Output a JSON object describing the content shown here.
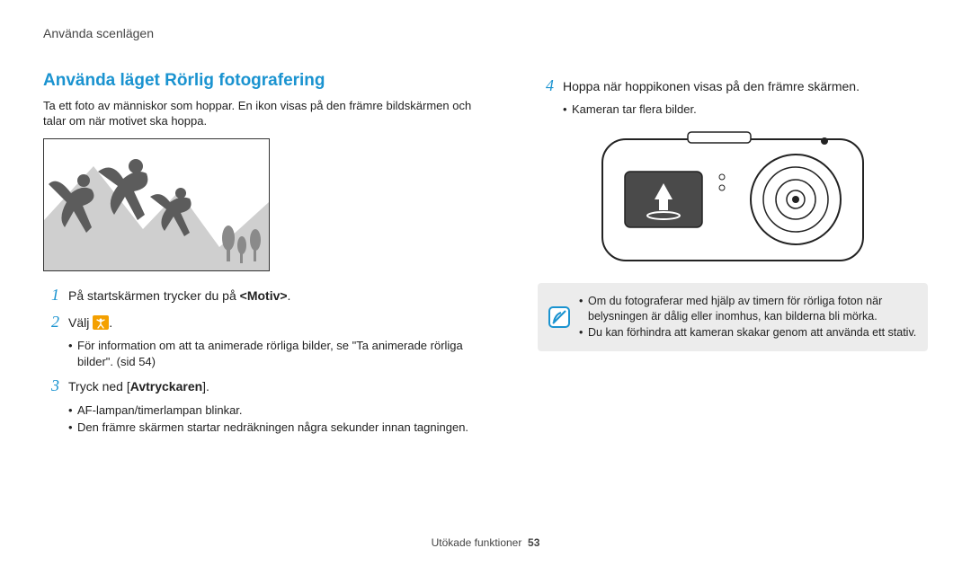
{
  "header": {
    "breadcrumb": "Använda scenlägen"
  },
  "left": {
    "title": "Använda läget Rörlig fotografering",
    "intro": "Ta ett foto av människor som hoppar. En ikon visas på den främre bildskärmen och talar om när motivet ska hoppa.",
    "step1": {
      "num": "1",
      "pre": "På startskärmen trycker du på ",
      "bold": "<Motiv>",
      "post": "."
    },
    "step2": {
      "num": "2",
      "pre": "Välj ",
      "icon_name": "jump-mode-icon",
      "post": "."
    },
    "step2_bullets": [
      "För information om att ta animerade rörliga bilder, se \"Ta animerade rörliga bilder\". (sid 54)"
    ],
    "step3": {
      "num": "3",
      "pre": "Tryck ned [",
      "bold": "Avtryckaren",
      "post": "]."
    },
    "step3_bullets": [
      "AF-lampan/timerlampan blinkar.",
      "Den främre skärmen startar nedräkningen några sekunder innan tagningen."
    ]
  },
  "right": {
    "step4": {
      "num": "4",
      "text": "Hoppa när hoppikonen visas på den främre skärmen."
    },
    "step4_bullets": [
      "Kameran tar flera bilder."
    ],
    "note_items": [
      "Om du fotograferar med hjälp av timern för rörliga foton när belysningen är dålig eller inomhus, kan bilderna bli mörka.",
      "Du kan förhindra att kameran skakar genom att använda ett stativ."
    ]
  },
  "footer": {
    "section": "Utökade funktioner",
    "page": "53"
  }
}
